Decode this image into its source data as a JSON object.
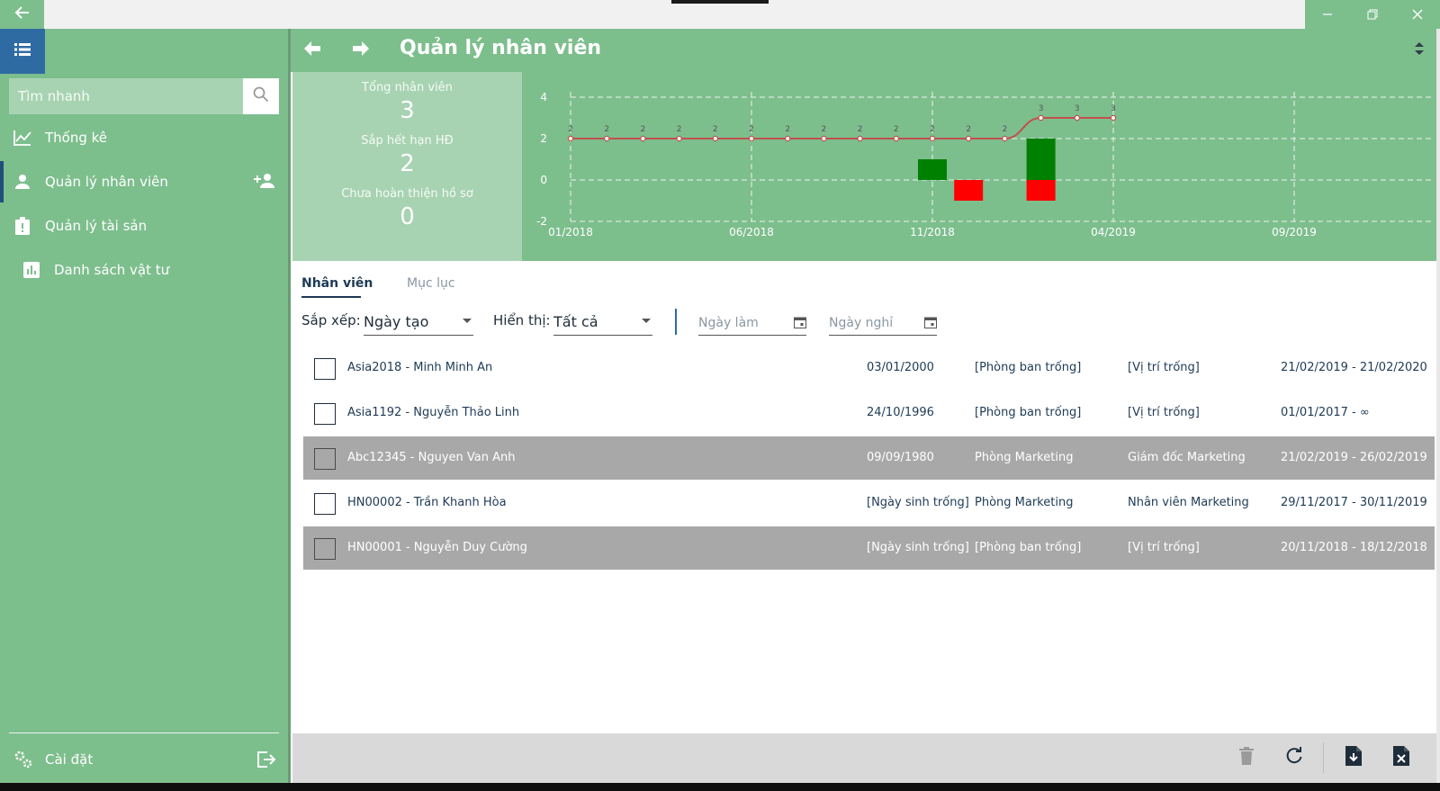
{
  "window": {
    "back_icon": "arrow-left-icon",
    "controls": [
      "minimize",
      "restore",
      "close"
    ]
  },
  "sidebar": {
    "search_placeholder": "Tìm nhanh",
    "items": [
      {
        "label": "Thống kê",
        "icon": "chart-line-icon"
      },
      {
        "label": "Quản lý nhân viên",
        "icon": "person-icon",
        "active": true,
        "extra_icon": "add-person-icon"
      },
      {
        "label": "Quản lý tài sản",
        "icon": "clipboard-alert-icon"
      },
      {
        "label": "Danh sách vật tư",
        "icon": "bar-chart-icon"
      }
    ],
    "settings_label": "Cài đặt"
  },
  "header": {
    "title": "Quản lý nhân viên"
  },
  "stats": [
    {
      "label": "Tổng nhân viên",
      "value": "3"
    },
    {
      "label": "Sắp hết hạn HĐ",
      "value": "2"
    },
    {
      "label": "Chưa hoàn thiện hồ sơ",
      "value": "0"
    }
  ],
  "chart_data": {
    "type": "line",
    "x_ticks": [
      "01/2018",
      "06/2018",
      "11/2018",
      "04/2019",
      "09/2019"
    ],
    "y_ticks": [
      "4",
      "2",
      "0",
      "-2"
    ],
    "ylim": [
      -2,
      4
    ],
    "grid": true,
    "series": [
      {
        "type": "line",
        "color": "#c0504d",
        "x": [
          "01/2018",
          "02/2018",
          "03/2018",
          "04/2018",
          "05/2018",
          "06/2018",
          "07/2018",
          "08/2018",
          "09/2018",
          "10/2018",
          "11/2018",
          "12/2018",
          "01/2019",
          "02/2019",
          "03/2019",
          "04/2019"
        ],
        "values": [
          2,
          2,
          2,
          2,
          2,
          2,
          2,
          2,
          2,
          2,
          2,
          2,
          2,
          3,
          3,
          3
        ],
        "labels": [
          "2",
          "2",
          "2",
          "2",
          "2",
          "2",
          "2",
          "2",
          "2",
          "2",
          "2",
          "2",
          "2",
          "3",
          "3",
          "3"
        ]
      },
      {
        "type": "bar",
        "color": "#008000",
        "x": [
          "11/2018",
          "02/2019"
        ],
        "values": [
          1,
          2
        ]
      },
      {
        "type": "bar",
        "color": "#ff0000",
        "x": [
          "12/2018",
          "02/2019"
        ],
        "values": [
          -1,
          -1
        ]
      }
    ]
  },
  "tabs": {
    "employees": "Nhân viên",
    "index": "Mục lục"
  },
  "filters": {
    "sort_label": "Sắp xếp:",
    "sort_value": "Ngày tạo",
    "display_label": "Hiển thị:",
    "display_value": "Tất cả",
    "start_date_placeholder": "Ngày làm",
    "end_date_placeholder": "Ngày nghỉ"
  },
  "employees": [
    {
      "name": "Asia2018 - Minh Minh An",
      "dob": "03/01/2000",
      "department": "[Phòng ban trống]",
      "position": "[Vị trí trống]",
      "period": "21/02/2019 - 21/02/2020",
      "selected": false
    },
    {
      "name": "Asia1192 - Nguyễn Thảo Linh",
      "dob": "24/10/1996",
      "department": "[Phòng ban trống]",
      "position": "[Vị trí trống]",
      "period": "01/01/2017 - ∞",
      "selected": false
    },
    {
      "name": "Abc12345 - Nguyen Van Anh",
      "dob": "09/09/1980",
      "department": "Phòng Marketing",
      "position": "Giám đốc Marketing",
      "period": "21/02/2019 - 26/02/2019",
      "selected": true
    },
    {
      "name": "HN00002 - Trần Khanh Hòa",
      "dob": "[Ngày sinh trống]",
      "department": "Phòng Marketing",
      "position": "Nhân viên Marketing",
      "period": "29/11/2017 - 30/11/2019",
      "selected": false
    },
    {
      "name": "HN00001 - Nguyễn Duy Cường",
      "dob": "[Ngày sinh trống]",
      "department": "[Phòng ban trống]",
      "position": "[Vị trí trống]",
      "period": "20/11/2018 - 18/12/2018",
      "selected": true
    }
  ],
  "toolbar": {
    "buttons": [
      "delete-icon",
      "refresh-icon",
      "import-file-icon",
      "export-file-icon"
    ]
  }
}
